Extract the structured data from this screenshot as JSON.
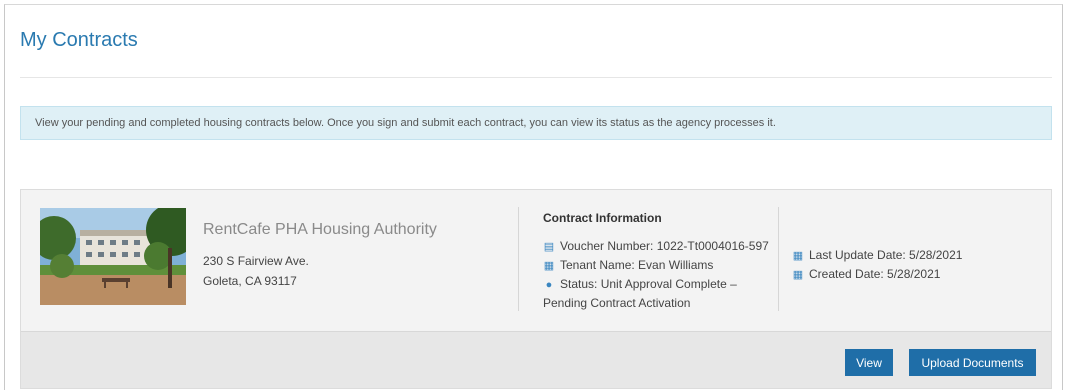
{
  "page": {
    "title": "My Contracts",
    "info_banner": "View your pending and completed housing contracts below. Once you sign and submit each contract, you can view its status as the agency processes it."
  },
  "contract": {
    "property_name": "RentCafe PHA Housing Authority",
    "address_line1": "230 S Fairview Ave.",
    "address_line2": "Goleta, CA 93117",
    "info_heading": "Contract Information",
    "voucher": "Voucher Number: 1022-Tt0004016-597",
    "tenant": "Tenant Name: Evan Williams",
    "status_line1": "Status: Unit Approval Complete –",
    "status_line2": "Pending Contract Activation",
    "last_update": "Last Update Date: 5/28/2021",
    "created": "Created Date: 5/28/2021"
  },
  "actions": {
    "view_label": "View",
    "upload_label": "Upload Documents"
  },
  "icons": {
    "voucher": "id-card-icon",
    "tenant": "calendar-icon",
    "status": "user-icon",
    "last_update": "calendar-icon",
    "created": "calendar-icon"
  },
  "colors": {
    "title": "#2a7ab0",
    "banner_bg": "#dff0f6",
    "button_bg": "#1f6ea8",
    "icon": "#3a86c0"
  }
}
